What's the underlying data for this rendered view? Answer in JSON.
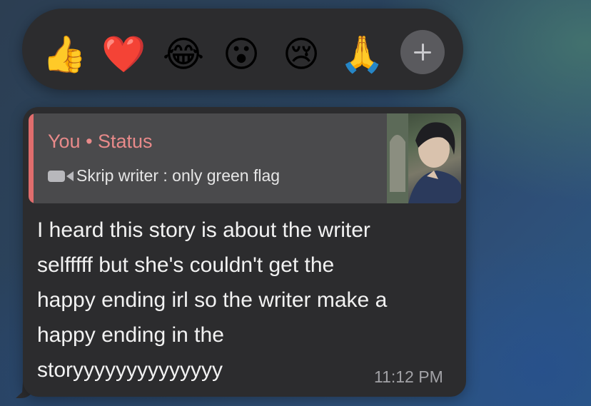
{
  "reactions": [
    {
      "emoji": "👍",
      "name": "thumbs-up"
    },
    {
      "emoji": "❤️",
      "name": "red-heart"
    },
    {
      "emoji": "😂",
      "name": "tears-of-joy"
    },
    {
      "emoji": "😮",
      "name": "surprised"
    },
    {
      "emoji": "😢",
      "name": "crying"
    },
    {
      "emoji": "🙏",
      "name": "folded-hands"
    }
  ],
  "more_reactions_icon": "plus-icon",
  "reply": {
    "title": "You • Status",
    "subtitle": "Skrip writer : only green flag",
    "icon": "video-camera-icon",
    "accent_color": "#e06d6d"
  },
  "message": {
    "line1": "I heard this story is about the writer",
    "line2": "selfffff but she's couldn't get the",
    "line3": "happy ending irl so the writer make a",
    "line4": "happy ending in the",
    "line5": "storyyyyyyyyyyyyyy",
    "time": "11:12 PM"
  }
}
